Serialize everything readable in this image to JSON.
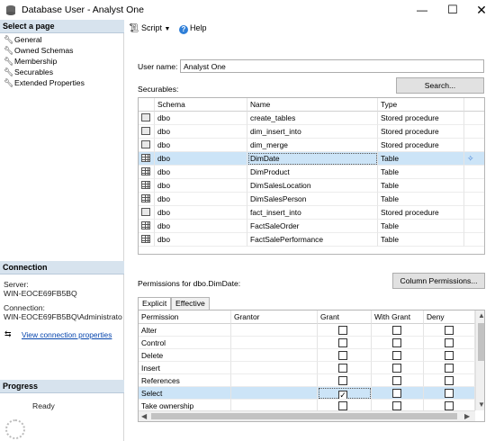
{
  "window": {
    "title": "Database User - Analyst One"
  },
  "left_pane": {
    "select_page_header": "Select a page",
    "pages": [
      {
        "label": "General"
      },
      {
        "label": "Owned Schemas"
      },
      {
        "label": "Membership"
      },
      {
        "label": "Securables",
        "selected": true
      },
      {
        "label": "Extended Properties"
      }
    ],
    "connection_header": "Connection",
    "server_label": "Server:",
    "server_value": "WIN-EOCE69FB5BQ",
    "connection_label": "Connection:",
    "connection_value": "WIN-EOCE69FB5BQ\\Administrato",
    "view_connection_link": "View connection properties",
    "progress_header": "Progress",
    "progress_status": "Ready"
  },
  "toolbar": {
    "script_label": "Script",
    "help_label": "Help"
  },
  "user": {
    "label": "User name:",
    "value": "Analyst One"
  },
  "securables": {
    "label": "Securables:",
    "search_button": "Search...",
    "columns": [
      "Schema",
      "Name",
      "Type"
    ],
    "rows": [
      {
        "icon": "stored-procedure-icon",
        "schema": "dbo",
        "name": "create_tables",
        "type": "Stored procedure"
      },
      {
        "icon": "stored-procedure-icon",
        "schema": "dbo",
        "name": "dim_insert_into",
        "type": "Stored procedure"
      },
      {
        "icon": "stored-procedure-icon",
        "schema": "dbo",
        "name": "dim_merge",
        "type": "Stored procedure"
      },
      {
        "icon": "table-icon",
        "schema": "dbo",
        "name": "DimDate",
        "type": "Table",
        "selected": true
      },
      {
        "icon": "table-icon",
        "schema": "dbo",
        "name": "DimProduct",
        "type": "Table"
      },
      {
        "icon": "table-icon",
        "schema": "dbo",
        "name": "DimSalesLocation",
        "type": "Table"
      },
      {
        "icon": "table-icon",
        "schema": "dbo",
        "name": "DimSalesPerson",
        "type": "Table"
      },
      {
        "icon": "stored-procedure-icon",
        "schema": "dbo",
        "name": "fact_insert_into",
        "type": "Stored procedure"
      },
      {
        "icon": "table-icon",
        "schema": "dbo",
        "name": "FactSaleOrder",
        "type": "Table"
      },
      {
        "icon": "table-icon",
        "schema": "dbo",
        "name": "FactSalePerformance",
        "type": "Table"
      }
    ]
  },
  "permissions": {
    "label": "Permissions for dbo.DimDate:",
    "column_permissions_button": "Column Permissions...",
    "tabs": [
      "Explicit",
      "Effective"
    ],
    "columns": [
      "Permission",
      "Grantor",
      "Grant",
      "With Grant",
      "Deny"
    ],
    "rows": [
      {
        "permission": "Alter",
        "grantor": "",
        "grant": false,
        "with_grant": false,
        "deny": false
      },
      {
        "permission": "Control",
        "grantor": "",
        "grant": false,
        "with_grant": false,
        "deny": false
      },
      {
        "permission": "Delete",
        "grantor": "",
        "grant": false,
        "with_grant": false,
        "deny": false
      },
      {
        "permission": "Insert",
        "grantor": "",
        "grant": false,
        "with_grant": false,
        "deny": false
      },
      {
        "permission": "References",
        "grantor": "",
        "grant": false,
        "with_grant": false,
        "deny": false
      },
      {
        "permission": "Select",
        "grantor": "",
        "grant": true,
        "with_grant": false,
        "deny": false,
        "selected": true
      },
      {
        "permission": "Take ownership",
        "grantor": "",
        "grant": false,
        "with_grant": false,
        "deny": false
      }
    ]
  },
  "colors": {
    "header_bg": "#d7e3ee",
    "selection_bg": "#cce4f7",
    "link": "#0645ad"
  }
}
